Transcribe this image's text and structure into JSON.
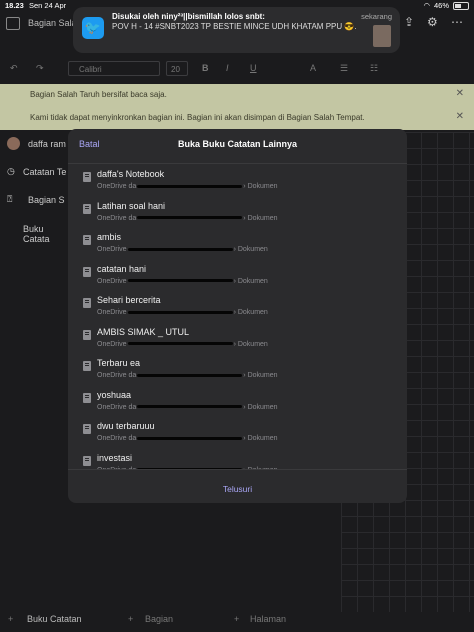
{
  "status_bar": {
    "time": "18.23",
    "date": "Sen 24 Apr",
    "battery": "46%",
    "battery_level": 0.46
  },
  "top_bar": {
    "section_title": "Bagian Salah"
  },
  "ribbon": {
    "font": "Calibri",
    "size": "20"
  },
  "banners": [
    "Bagian Salah Taruh bersifat baca saja.",
    "Kami tidak dapat menyinkronkan bagian ini. Bagian ini akan disimpan di Bagian Salah Tempat."
  ],
  "left_panel": {
    "user": "daffa ram",
    "items": [
      "Catatan Te",
      "Bagian S",
      "Buku Catata"
    ]
  },
  "bottom_bar": {
    "notebooks": "Buku Catatan",
    "sections": "Bagian",
    "pages": "Halaman"
  },
  "notification": {
    "app_icon": "twitter-icon",
    "title": "Disukai oleh niny²³||bismillah lolos snbt:",
    "body": "POV H - 14 #SNBT2023 TP BESTIE MINCE UDH KHATAM PPU 😎.",
    "time": "sekarang"
  },
  "modal": {
    "cancel_label": "Batal",
    "title": "Buka Buku Catatan Lainnya",
    "browse_label": "Telusuri",
    "notebooks": [
      {
        "name": "daffa's Notebook",
        "path_prefix": "OneDrive da",
        "path_suffix": "› Dokumen"
      },
      {
        "name": "Latihan soal hani",
        "path_prefix": "OneDrive da",
        "path_suffix": "› Dokumen"
      },
      {
        "name": "ambis",
        "path_prefix": "OneDrive",
        "path_suffix": "› Dokumen"
      },
      {
        "name": "catatan hani",
        "path_prefix": "OneDrive",
        "path_suffix": "› Dokumen"
      },
      {
        "name": "Sehari bercerita",
        "path_prefix": "OneDrive",
        "path_suffix": "› Dokumen"
      },
      {
        "name": "AMBIS SIMAK _ UTUL",
        "path_prefix": "OneDrive",
        "path_suffix": "› Dokumen"
      },
      {
        "name": "Terbaru ea",
        "path_prefix": "OneDrive da",
        "path_suffix": "› Dokumen"
      },
      {
        "name": "yoshuaa",
        "path_prefix": "OneDrive da",
        "path_suffix": "› Dokumen"
      },
      {
        "name": "dwu terbaruuu",
        "path_prefix": "OneDrive da",
        "path_suffix": "› Dokumen"
      },
      {
        "name": "investasi",
        "path_prefix": "OneDrive da",
        "path_suffix": "› Dokumen"
      }
    ]
  },
  "colors": {
    "accent": "#a9a6f5",
    "banner": "#c3c6a3",
    "twitter": "#1d9bf0"
  }
}
